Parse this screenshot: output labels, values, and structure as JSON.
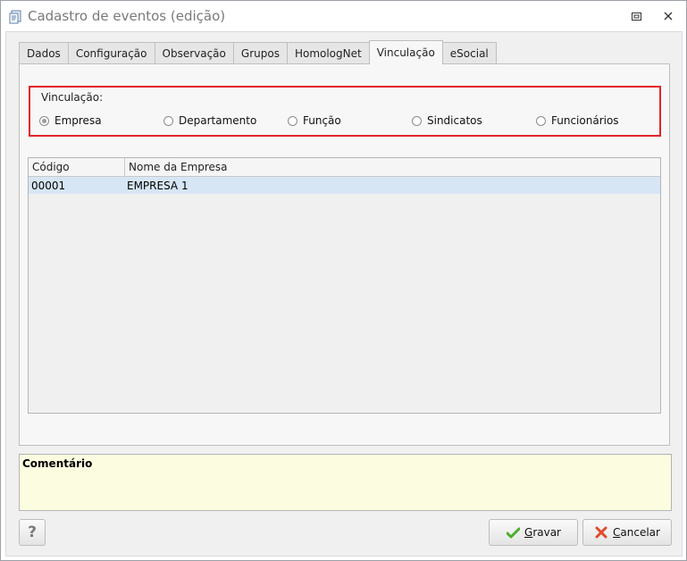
{
  "window": {
    "title": "Cadastro de eventos (edição)",
    "restore_icon": "restore-icon",
    "close_icon": "close-icon"
  },
  "tabs": [
    {
      "label": "Dados",
      "active": false
    },
    {
      "label": "Configuração",
      "active": false
    },
    {
      "label": "Observação",
      "active": false
    },
    {
      "label": "Grupos",
      "active": false
    },
    {
      "label": "HomologNet",
      "active": false
    },
    {
      "label": "Vinculação",
      "active": true
    },
    {
      "label": "eSocial",
      "active": false
    }
  ],
  "vinculacao": {
    "group_label": "Vinculação:",
    "options": [
      {
        "label": "Empresa",
        "checked": true
      },
      {
        "label": "Departamento",
        "checked": false
      },
      {
        "label": "Função",
        "checked": false
      },
      {
        "label": "Sindicatos",
        "checked": false
      },
      {
        "label": "Funcionários",
        "checked": false
      }
    ]
  },
  "grid": {
    "columns": [
      "Código",
      "Nome da Empresa"
    ],
    "rows": [
      {
        "codigo": "00001",
        "nome": "EMPRESA 1",
        "selected": true
      }
    ]
  },
  "comment": {
    "label": "Comentário"
  },
  "buttons": {
    "help_label": "?",
    "gravar_label": "Gravar",
    "cancelar_label": "Cancelar"
  },
  "colors": {
    "highlight_border": "#e3232a",
    "selected_row": "#d7e6f5",
    "comment_bg": "#fcfce0"
  }
}
